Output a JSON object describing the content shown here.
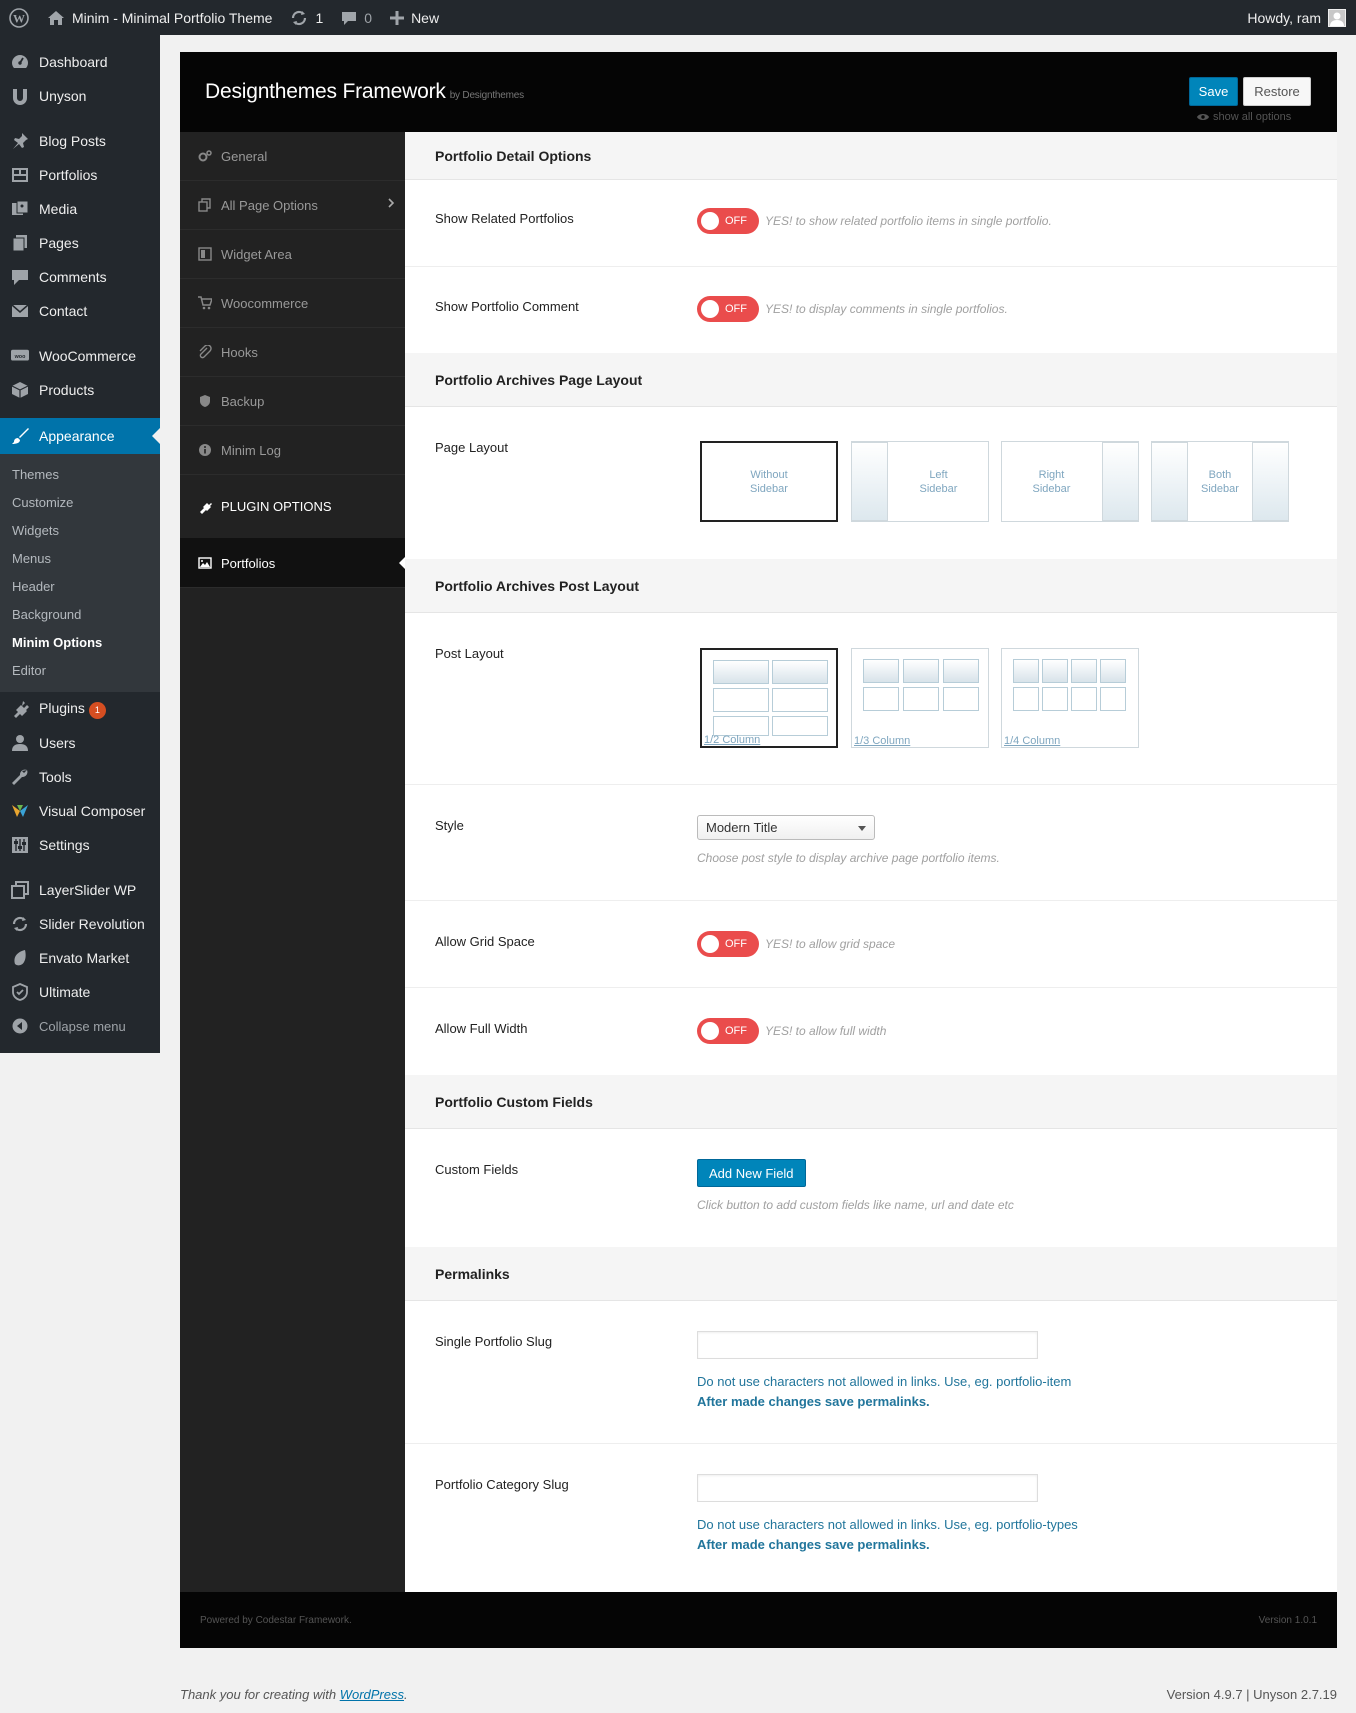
{
  "adminbar": {
    "site_name": "Minim - Minimal Portfolio Theme",
    "updates": "1",
    "comments": "0",
    "new_label": "New",
    "howdy": "Howdy, ram"
  },
  "menu": {
    "dashboard": "Dashboard",
    "unyson": "Unyson",
    "blog_posts": "Blog Posts",
    "portfolios": "Portfolios",
    "media": "Media",
    "pages": "Pages",
    "comments": "Comments",
    "contact": "Contact",
    "woocommerce": "WooCommerce",
    "products": "Products",
    "appearance": "Appearance",
    "sub": [
      "Themes",
      "Customize",
      "Widgets",
      "Menus",
      "Header",
      "Background",
      "Minim Options",
      "Editor"
    ],
    "plugins": "Plugins",
    "plugins_badge": "1",
    "users": "Users",
    "tools": "Tools",
    "visual_composer": "Visual Composer",
    "settings": "Settings",
    "layerslider": "LayerSlider WP",
    "slider_revolution": "Slider Revolution",
    "envato": "Envato Market",
    "ultimate": "Ultimate",
    "collapse": "Collapse menu"
  },
  "framework": {
    "title": "Designthemes Framework",
    "by": "by Designthemes",
    "save": "Save",
    "restore": "Restore",
    "show_all": "show all options"
  },
  "nav": {
    "general": "General",
    "all_page_options": "All Page Options",
    "widget_area": "Widget Area",
    "woocommerce": "Woocommerce",
    "hooks": "Hooks",
    "backup": "Backup",
    "minim_log": "Minim Log",
    "plugin_options": "PLUGIN OPTIONS",
    "portfolios": "Portfolios"
  },
  "content": {
    "detail_head": "Portfolio Detail Options",
    "related_label": "Show Related Portfolios",
    "related_help": "YES! to show related portfolio items in single portfolio.",
    "comment_label": "Show Portfolio Comment",
    "comment_help": "YES! to display comments in single portfolios.",
    "off": "OFF",
    "archive_page_head": "Portfolio Archives Page Layout",
    "page_layout_label": "Page Layout",
    "layouts": [
      "Without\nSidebar",
      "Left\nSidebar",
      "Right\nSidebar",
      "Both\nSidebar"
    ],
    "archive_post_head": "Portfolio Archives Post Layout",
    "post_layout_label": "Post Layout",
    "post_layouts": [
      "1/2 Column",
      "1/3 Column",
      "1/4 Column"
    ],
    "style_label": "Style",
    "style_value": "Modern Title",
    "style_help": "Choose post style to display archive page portfolio items.",
    "grid_label": "Allow Grid Space",
    "grid_help": "YES! to allow grid space",
    "full_label": "Allow Full Width",
    "full_help": "YES! to allow full width",
    "custom_head": "Portfolio Custom Fields",
    "custom_label": "Custom Fields",
    "add_field": "Add New Field",
    "custom_help": "Click button to add custom fields like name, url and date etc",
    "permalinks_head": "Permalinks",
    "single_slug_label": "Single Portfolio Slug",
    "single_slug_help": "Do not use characters not allowed in links. Use, eg. portfolio-item",
    "save_permalinks": "After made changes save permalinks.",
    "cat_slug_label": "Portfolio Category Slug",
    "cat_slug_help": "Do not use characters not allowed in links. Use, eg. portfolio-types"
  },
  "fw_footer": {
    "left": "Powered by Codestar Framework.",
    "right": "Version 1.0.1"
  },
  "wp_footer": {
    "thanks": "Thank you for creating with ",
    "wp": "WordPress",
    "dot": ".",
    "version": "Version 4.9.7 | Unyson 2.7.19"
  }
}
